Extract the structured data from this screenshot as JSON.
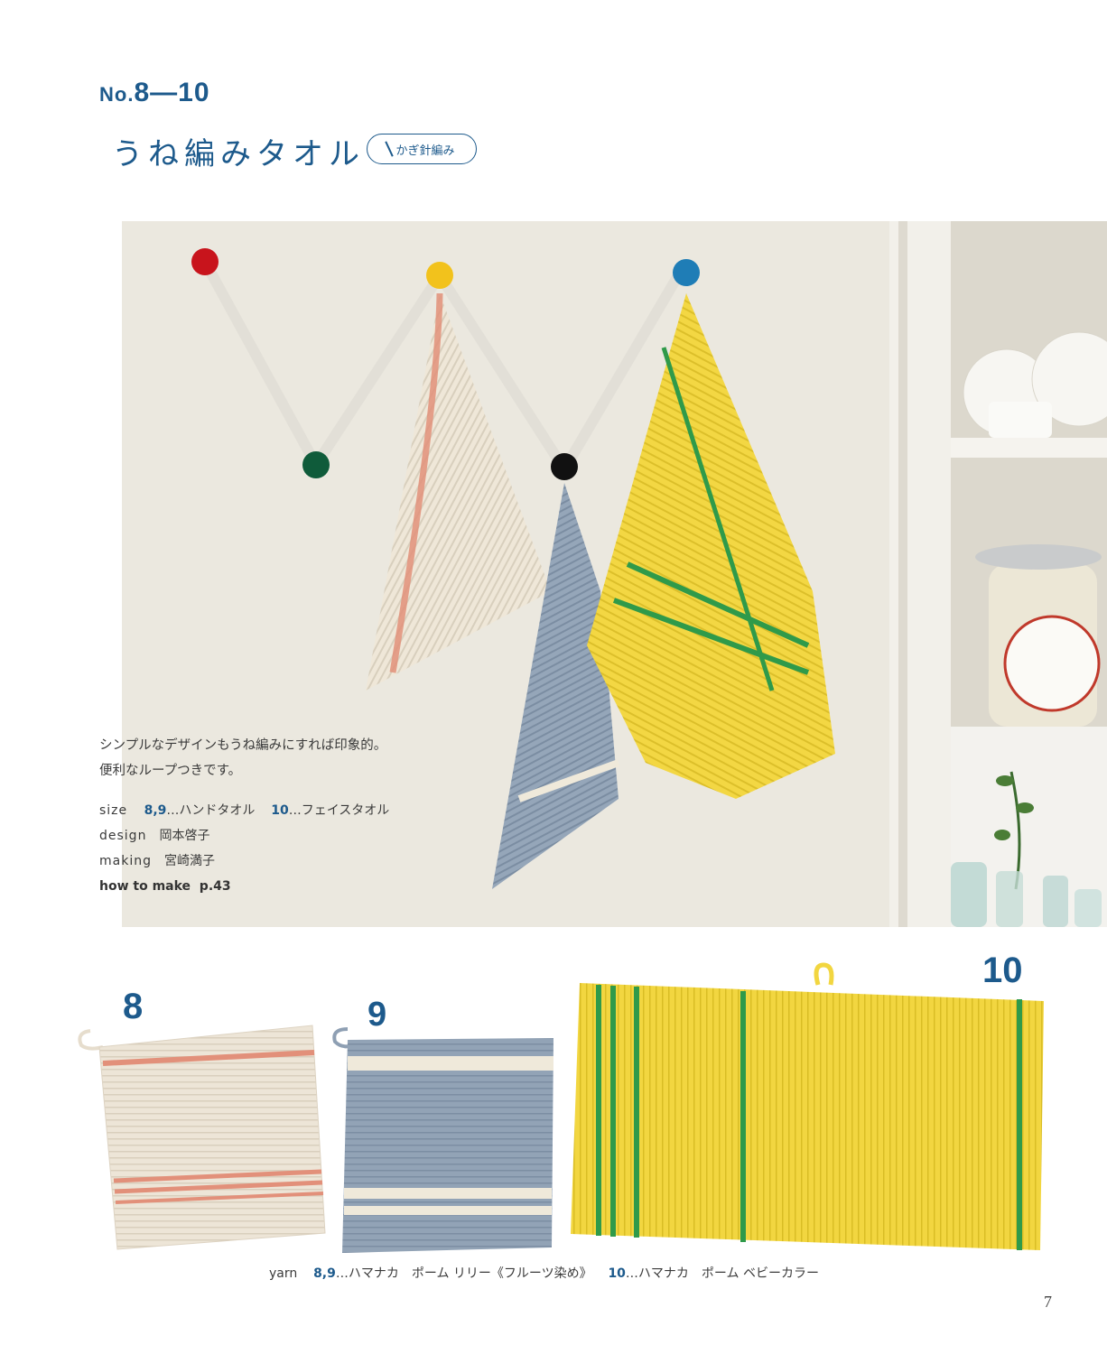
{
  "header": {
    "number_prefix": "No.",
    "number_range": "8—10",
    "title": "うね編みタオル",
    "badge": "かぎ針編み"
  },
  "description": {
    "line1": "シンプルなデザインもうね編みにすれば印象的。",
    "line2": "便利なループつきです。"
  },
  "info": {
    "size_label": "size",
    "size_num1": "8,9",
    "size_text1": "…ハンドタオル",
    "size_num2": "10",
    "size_text2": "…フェイスタオル",
    "design_label": "design",
    "design_value": "岡本啓子",
    "making_label": "making",
    "making_value": "宮崎満子",
    "howto_label": "how to make",
    "howto_page": "p.43"
  },
  "products": {
    "p8": "8",
    "p9": "9",
    "p10": "10"
  },
  "yarn": {
    "label": "yarn",
    "num1": "8,9",
    "text1": "…ハマナカ　ポーム リリー《フルーツ染め》",
    "num2": "10",
    "text2": "…ハマナカ　ポーム ベビーカラー"
  },
  "page_number": "7",
  "colors": {
    "accent": "#1d5a8c",
    "towel8": "#ece4d6",
    "towel8_stripe": "#e2907a",
    "towel9": "#8e9fb3",
    "towel9_stripe": "#efe9da",
    "towel10": "#f2d640",
    "towel10_stripe": "#2f9a4a"
  }
}
